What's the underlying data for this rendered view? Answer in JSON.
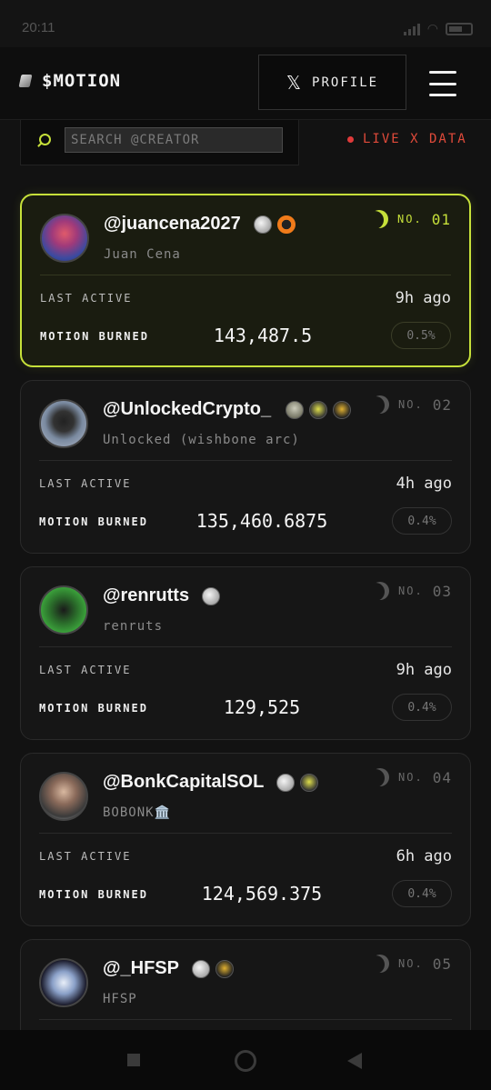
{
  "status_bar": {
    "time": "20:11"
  },
  "header": {
    "brand": "$MOTION",
    "profile_icon": "x-logo-icon",
    "profile_label": "PROFILE",
    "menu_icon": "hamburger-icon"
  },
  "search": {
    "placeholder": "SEARCH @CREATOR",
    "value": ""
  },
  "live": {
    "label": "LIVE X DATA",
    "dot_color": "#e03a3a"
  },
  "accent": "#c6e03a",
  "labels": {
    "last_active": "LAST ACTIVE",
    "motion_burned": "MOTION BURNED",
    "rank_prefix": "NO."
  },
  "creators": [
    {
      "handle": "@juancena2027",
      "name": "Juan Cena",
      "rank": "01",
      "last_active": "9h ago",
      "motion_burned": "143,487.5",
      "share": "0.5%",
      "highlighted": true
    },
    {
      "handle": "@UnlockedCrypto_",
      "name": "Unlocked (wishbone arc)",
      "rank": "02",
      "last_active": "4h ago",
      "motion_burned": "135,460.6875",
      "share": "0.4%",
      "highlighted": false
    },
    {
      "handle": "@renrutts",
      "name": "renruts",
      "rank": "03",
      "last_active": "9h ago",
      "motion_burned": "129,525",
      "share": "0.4%",
      "highlighted": false
    },
    {
      "handle": "@BonkCapitalSOL",
      "name": "BOBONK🏛️",
      "rank": "04",
      "last_active": "6h ago",
      "motion_burned": "124,569.375",
      "share": "0.4%",
      "highlighted": false
    },
    {
      "handle": "@_HFSP",
      "name": "HFSP",
      "rank": "05"
    }
  ]
}
